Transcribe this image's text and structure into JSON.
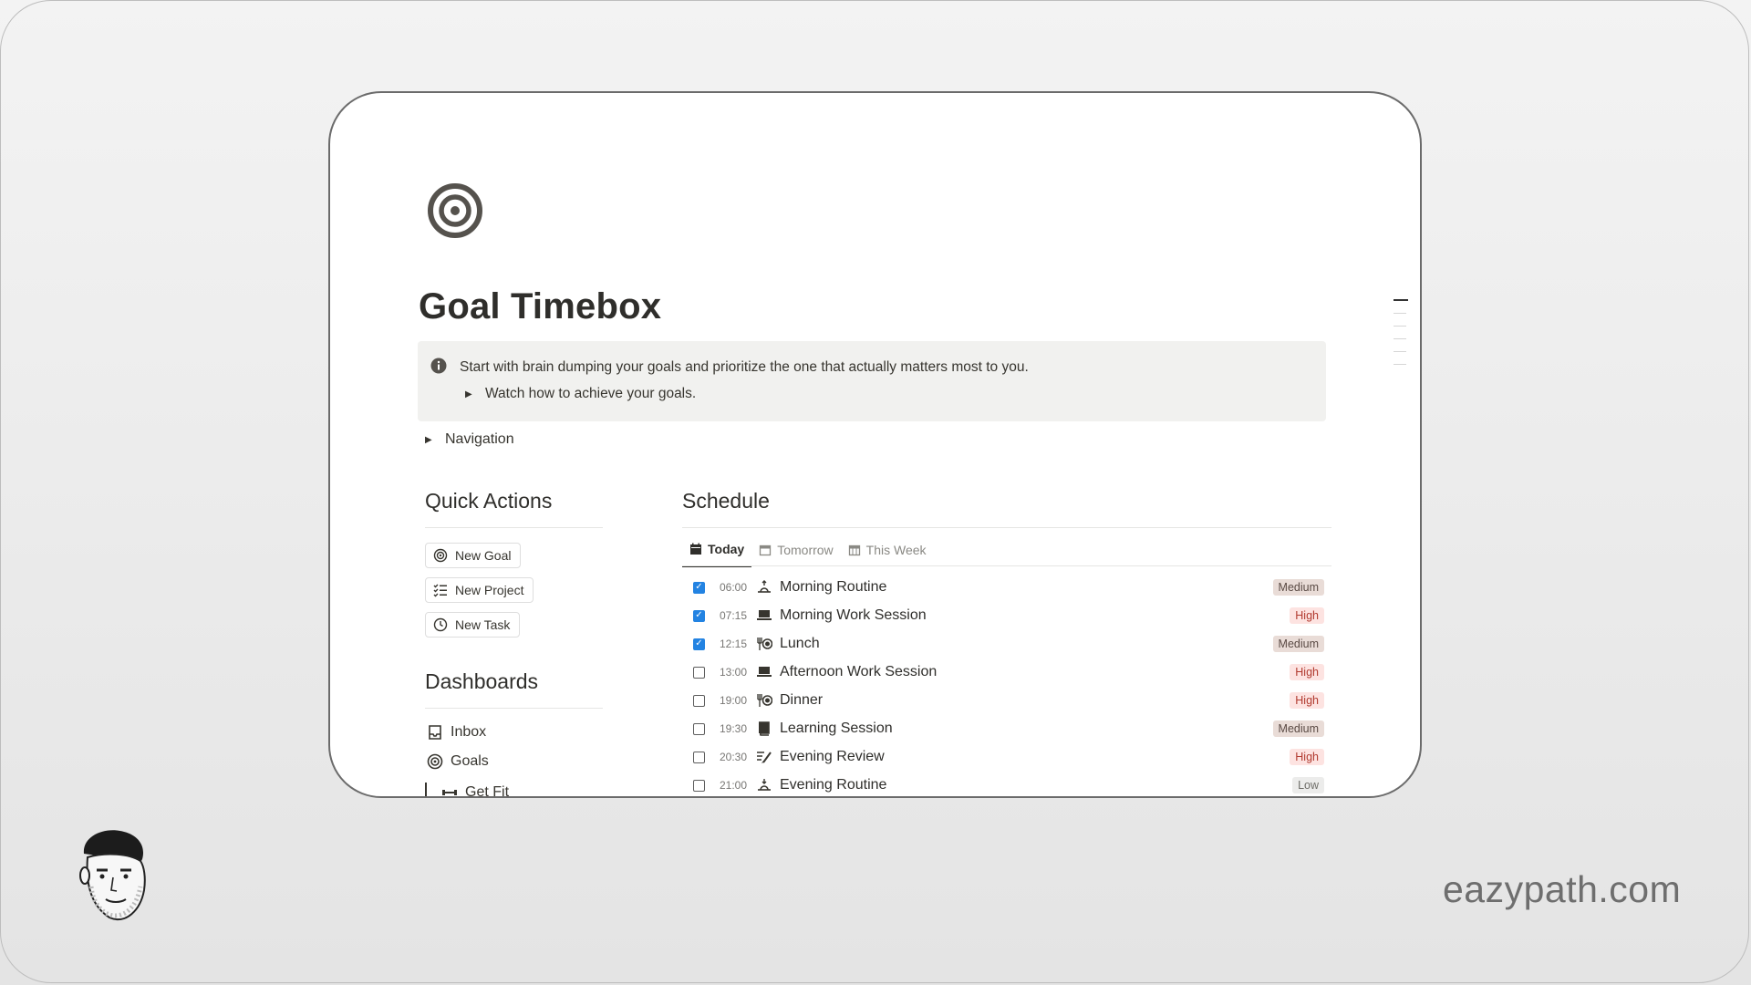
{
  "page": {
    "title": "Goal Timebox",
    "icon": "target-icon"
  },
  "callout": {
    "icon": "info-icon",
    "text": "Start with brain dumping your goals and prioritize the one that actually matters most to you.",
    "toggle_label": "Watch how to achieve your goals."
  },
  "navigation": {
    "label": "Navigation"
  },
  "quick_actions": {
    "heading": "Quick Actions",
    "buttons": [
      {
        "label": "New Goal",
        "icon": "target-icon"
      },
      {
        "label": "New Project",
        "icon": "checklist-icon"
      },
      {
        "label": "New Task",
        "icon": "clock-icon"
      }
    ]
  },
  "dashboards": {
    "heading": "Dashboards",
    "items": [
      {
        "label": "Inbox",
        "icon": "inbox-icon"
      },
      {
        "label": "Goals",
        "icon": "target-icon"
      },
      {
        "label": "Get Fit",
        "icon": "dumbbell-icon"
      }
    ]
  },
  "schedule": {
    "heading": "Schedule",
    "tabs": [
      {
        "label": "Today",
        "icon": "calendar-icon",
        "active": true
      },
      {
        "label": "Tomorrow",
        "icon": "calendar-icon",
        "active": false
      },
      {
        "label": "This Week",
        "icon": "calendar-grid-icon",
        "active": false
      }
    ],
    "rows": [
      {
        "checked": true,
        "time": "06:00",
        "icon": "sunrise-icon",
        "title": "Morning Routine",
        "priority": "Medium"
      },
      {
        "checked": true,
        "time": "07:15",
        "icon": "laptop-icon",
        "title": "Morning Work Session",
        "priority": "High"
      },
      {
        "checked": true,
        "time": "12:15",
        "icon": "dining-icon",
        "title": "Lunch",
        "priority": "Medium"
      },
      {
        "checked": false,
        "time": "13:00",
        "icon": "laptop-icon",
        "title": "Afternoon Work Session",
        "priority": "High"
      },
      {
        "checked": false,
        "time": "19:00",
        "icon": "dining-icon",
        "title": "Dinner",
        "priority": "High"
      },
      {
        "checked": false,
        "time": "19:30",
        "icon": "book-icon",
        "title": "Learning Session",
        "priority": "Medium"
      },
      {
        "checked": false,
        "time": "20:30",
        "icon": "review-icon",
        "title": "Evening Review",
        "priority": "High"
      },
      {
        "checked": false,
        "time": "21:00",
        "icon": "sunset-icon",
        "title": "Evening Routine",
        "priority": "Low"
      }
    ]
  },
  "brand": {
    "text": "eazypath.com"
  },
  "colors": {
    "checkbox": "#2383e2",
    "medium_badge": "#e9dcd7",
    "high_badge": "#fde3e1",
    "low_badge": "#ececeb"
  }
}
